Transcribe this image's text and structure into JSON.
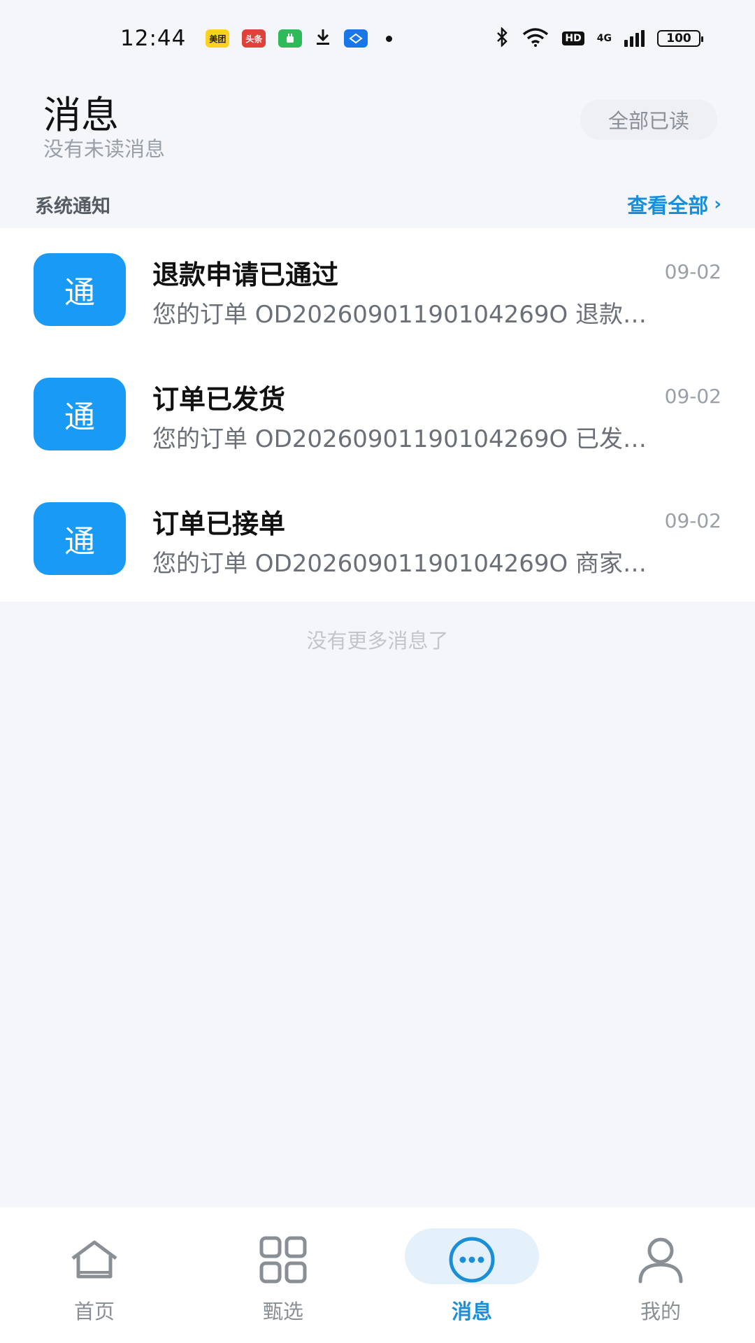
{
  "status_bar": {
    "time": "12:44",
    "apps": [
      {
        "name": "meituan-app-icon",
        "text": "美团"
      },
      {
        "name": "toutiao-app-icon",
        "text": "头条"
      },
      {
        "name": "green-app-icon",
        "text": ""
      },
      {
        "name": "download-icon",
        "text": ""
      },
      {
        "name": "blue-app-icon",
        "text": ""
      }
    ],
    "hd": "HD",
    "network": "4G",
    "battery": "100"
  },
  "header": {
    "title": "消息",
    "subtitle": "没有未读消息",
    "mark_all_read": "全部已读"
  },
  "section": {
    "title": "系统通知",
    "view_all": "查看全部",
    "chevron": "›"
  },
  "messages": [
    {
      "avatar_text": "通",
      "title": "退款申请已通过",
      "date": "09-02",
      "body": "您的订单 OD20260901190104269O 退款…"
    },
    {
      "avatar_text": "通",
      "title": "订单已发货",
      "date": "09-02",
      "body": "您的订单 OD20260901190104269O 已发…"
    },
    {
      "avatar_text": "通",
      "title": "订单已接单",
      "date": "09-02",
      "body": "您的订单 OD20260901190104269O 商家…"
    }
  ],
  "footer_note": "没有更多消息了",
  "nav": {
    "home": "首页",
    "select": "甄选",
    "messages": "消息",
    "mine": "我的"
  },
  "colors": {
    "accent": "#1a8fd8",
    "avatar_bg": "#199af5",
    "page_bg": "#f4f6fa"
  }
}
